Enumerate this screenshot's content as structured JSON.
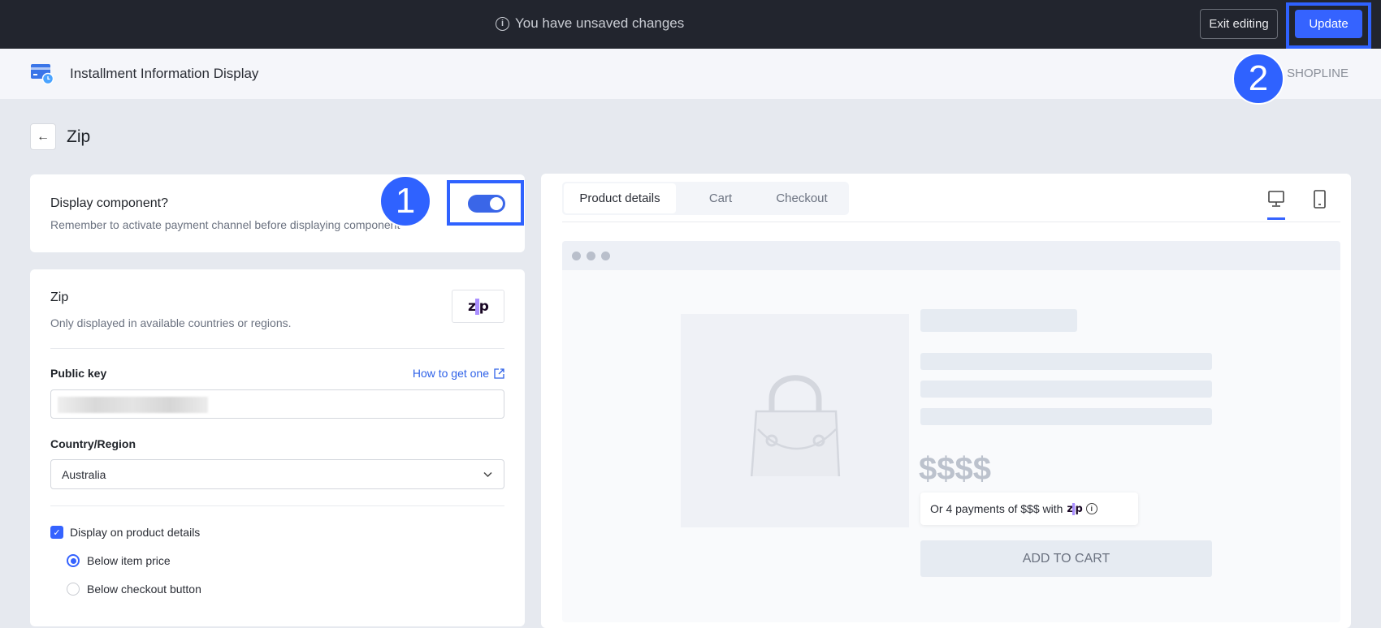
{
  "topbar": {
    "unsaved_message": "You have unsaved changes",
    "exit_label": "Exit editing",
    "update_label": "Update"
  },
  "header": {
    "app_title": "Installment Information Display",
    "developer": "D: SHOPLINE"
  },
  "annotations": {
    "step1": "1",
    "step2": "2"
  },
  "page": {
    "title": "Zip"
  },
  "display_card": {
    "title": "Display component?",
    "subtitle": "Remember to activate payment channel before displaying component",
    "enabled": true
  },
  "zip_card": {
    "title": "Zip",
    "subtitle": "Only displayed in available countries or regions.",
    "logo": "zip",
    "public_key_label": "Public key",
    "help_link": "How to get one",
    "country_label": "Country/Region",
    "country_value": "Australia",
    "display_on_product_details": {
      "label": "Display on product details",
      "checked": true
    },
    "placements": [
      {
        "label": "Below item price",
        "selected": true
      },
      {
        "label": "Below checkout button",
        "selected": false
      }
    ]
  },
  "preview": {
    "tabs": [
      {
        "label": "Product details",
        "active": true
      },
      {
        "label": "Cart"
      },
      {
        "label": "Checkout"
      }
    ],
    "device": "desktop",
    "price": "$$$$",
    "installment_text": "Or 4 payments of $$$ with",
    "add_to_cart": "ADD TO CART"
  },
  "colors": {
    "accent": "#3563ff",
    "topbar": "#22252e",
    "zip_purple": "#aa8fff"
  }
}
